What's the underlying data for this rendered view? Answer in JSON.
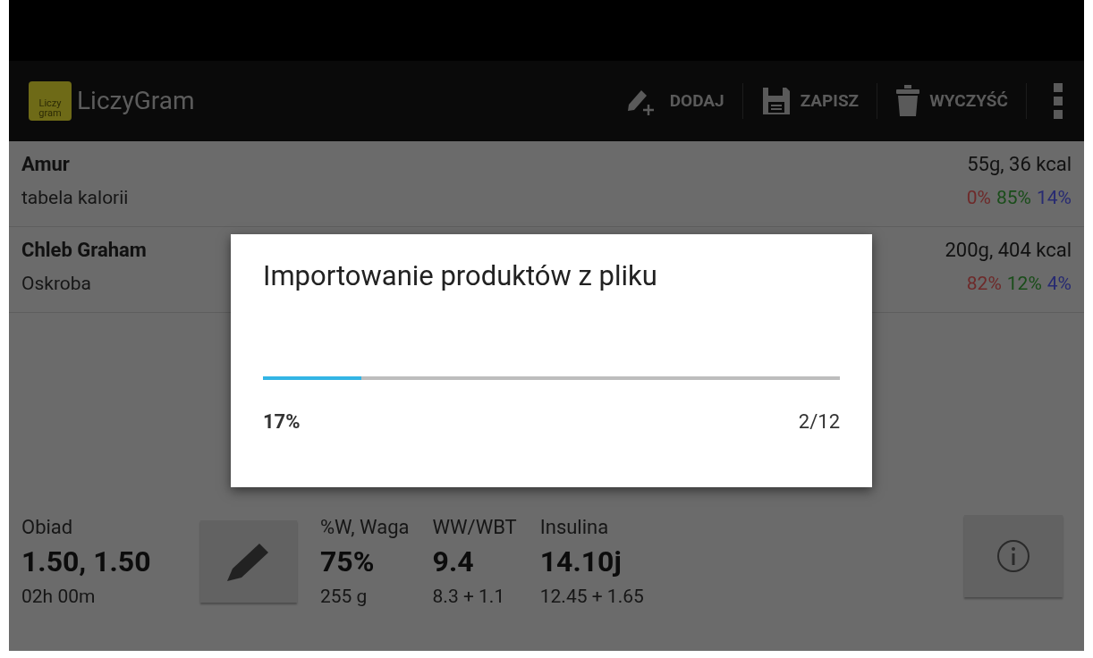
{
  "app_bar": {
    "title": "LiczyGram",
    "logo_text": [
      "Liczy",
      "gram"
    ],
    "actions": [
      {
        "kind": "add",
        "label": "DODAJ"
      },
      {
        "kind": "save",
        "label": "ZAPISZ"
      },
      {
        "kind": "clear",
        "label": "WYCZYŚĆ"
      }
    ]
  },
  "products": [
    {
      "name": "Amur",
      "source": "tabela kalorii",
      "amount": "55g, 36 kcal",
      "shares": [
        {
          "text": "0%",
          "color": "#6e2a2a"
        },
        {
          "text": "85%",
          "color": "#1a4d1a"
        },
        {
          "text": "14%",
          "color": "#272a72"
        }
      ]
    },
    {
      "name": "Chleb Graham",
      "source": "Oskroba",
      "amount": "200g, 404 kcal",
      "shares": [
        {
          "text": "82%",
          "color": "#6e2a2a"
        },
        {
          "text": "12%",
          "color": "#1a4d1a"
        },
        {
          "text": "4%",
          "color": "#272a72"
        }
      ]
    }
  ],
  "summary": {
    "meal": {
      "label": "Obiad",
      "value": "1.50, 1.50",
      "detail": "02h 00m"
    },
    "columns": [
      {
        "label": "%W, Waga",
        "value": "75%",
        "detail": "255 g"
      },
      {
        "label": "WW/WBT",
        "value": "9.4",
        "detail": "8.3 + 1.1"
      },
      {
        "label": "Insulina",
        "value": "14.10j",
        "detail": "12.45 + 1.65"
      }
    ]
  },
  "dialog": {
    "title": "Importowanie produktów z pliku",
    "level": 0.17,
    "percent": "17%",
    "count": "2/12"
  }
}
